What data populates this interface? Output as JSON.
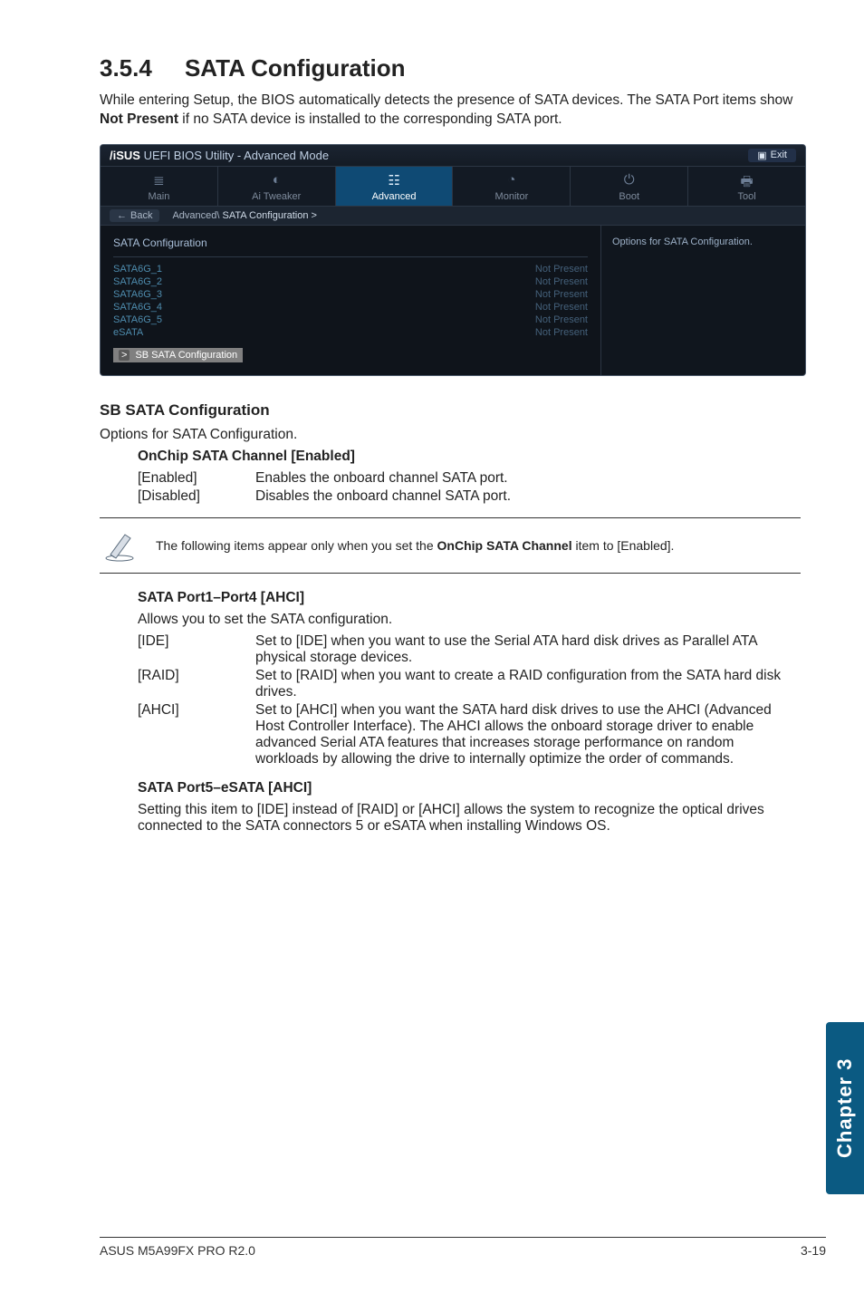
{
  "section": {
    "number": "3.5.4",
    "title": "SATA Configuration"
  },
  "lead": {
    "pre": "While entering Setup, the BIOS automatically detects the presence of SATA devices. The SATA Port items show ",
    "bold": "Not Present",
    "post": " if no SATA device is installed to the corresponding SATA port."
  },
  "bios": {
    "brand_prefix": "/iSUS",
    "title_rest": " UEFI BIOS Utility - Advanced Mode",
    "exit_label": "Exit",
    "tabs": [
      {
        "icon": "list-icon",
        "glyph": "≣",
        "label": "Main"
      },
      {
        "icon": "tweaker-icon",
        "glyph": "◐",
        "label": "Ai Tweaker"
      },
      {
        "icon": "advanced-icon",
        "glyph": "☷",
        "label": "Advanced",
        "active": true
      },
      {
        "icon": "monitor-icon",
        "glyph": "◔",
        "label": "Monitor"
      },
      {
        "icon": "boot-icon",
        "glyph": "⏻",
        "label": "Boot"
      },
      {
        "icon": "tool-icon",
        "glyph": "🖶",
        "label": "Tool"
      }
    ],
    "back_label": "Back",
    "breadcrumb_a": "Advanced\\",
    "breadcrumb_b": " SATA Configuration  >",
    "left_heading": "SATA Configuration",
    "rows": [
      {
        "k": "SATA6G_1",
        "v": "Not Present"
      },
      {
        "k": "SATA6G_2",
        "v": "Not Present"
      },
      {
        "k": "SATA6G_3",
        "v": "Not Present"
      },
      {
        "k": "SATA6G_4",
        "v": "Not Present"
      },
      {
        "k": "SATA6G_5",
        "v": "Not Present"
      },
      {
        "k": "eSATA",
        "v": "Not Present"
      }
    ],
    "selected_item_gt": ">",
    "selected_item": "SB SATA Configuration",
    "right_help": "Options for SATA Configuration."
  },
  "sb": {
    "heading": "SB SATA Configuration",
    "desc": "Options for SATA Configuration.",
    "onchip_heading": "OnChip SATA Channel [Enabled]",
    "opts": [
      {
        "k": "[Enabled]",
        "v": "Enables the onboard channel SATA port."
      },
      {
        "k": "[Disabled]",
        "v": "Disables the onboard channel SATA port."
      }
    ]
  },
  "note": {
    "pre": "The following items appear only when you set the ",
    "bold": "OnChip SATA Channel",
    "post": " item to [Enabled]."
  },
  "port14": {
    "heading": "SATA Port1–Port4 [AHCI]",
    "desc": "Allows you to set the SATA configuration.",
    "opts": [
      {
        "k": "[IDE]",
        "v": "Set to [IDE] when you want to use the Serial ATA hard disk drives as Parallel ATA physical storage devices."
      },
      {
        "k": "[RAID]",
        "v": "Set to [RAID] when you want to create a RAID configuration from the SATA hard disk drives."
      },
      {
        "k": "[AHCI]",
        "v": "Set to [AHCI] when you want the SATA hard disk drives to use the AHCI (Advanced Host Controller Interface). The AHCI allows the onboard storage driver to enable advanced Serial ATA features that increases storage performance on random workloads by allowing the drive to internally optimize the order of commands."
      }
    ]
  },
  "port5": {
    "heading": "SATA Port5–eSATA [AHCI]",
    "desc": "Setting this item to [IDE] instead of [RAID] or [AHCI] allows the system to recognize the optical drives connected to the SATA connectors 5 or eSATA when installing Windows OS."
  },
  "footer": {
    "left": "ASUS M5A99FX PRO R2.0",
    "right": "3-19"
  },
  "sidetab": "Chapter 3"
}
